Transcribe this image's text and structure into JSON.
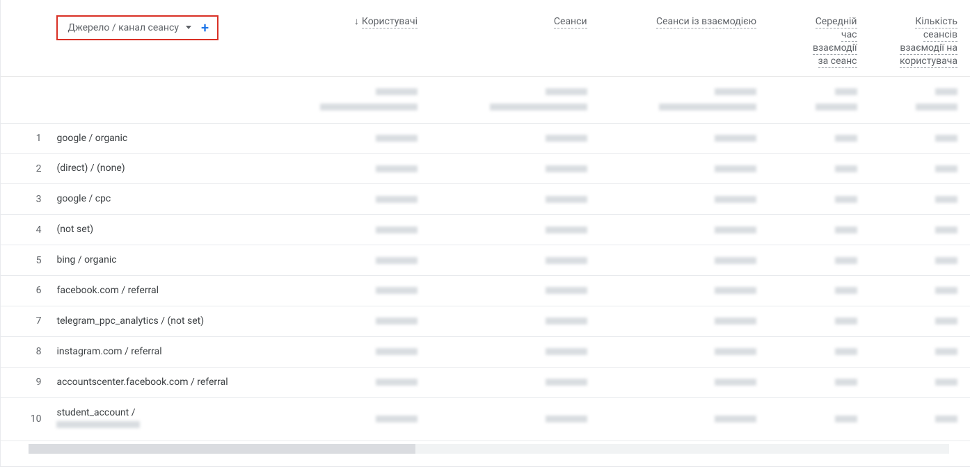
{
  "dimension": {
    "label": "Джерело / канал сеансу"
  },
  "columns": {
    "users": "Користувачі",
    "sessions": "Сеанси",
    "engaged_sessions": "Сеанси із взаємодією",
    "avg_engagement_time": [
      "Середній",
      "час",
      "взаємодії",
      "за сеанс"
    ],
    "sessions_per_user": [
      "Кількість",
      "сеансів",
      "взаємодії на",
      "користувача"
    ]
  },
  "sort": {
    "column": "users",
    "direction": "desc",
    "arrow": "↓"
  },
  "rows": [
    {
      "n": 1,
      "dim": "google / organic"
    },
    {
      "n": 2,
      "dim": "(direct) / (none)"
    },
    {
      "n": 3,
      "dim": "google / cpc"
    },
    {
      "n": 4,
      "dim": "(not set)"
    },
    {
      "n": 5,
      "dim": "bing / organic"
    },
    {
      "n": 6,
      "dim": "facebook.com / referral"
    },
    {
      "n": 7,
      "dim": "telegram_ppc_analytics / (not set)"
    },
    {
      "n": 8,
      "dim": "instagram.com / referral"
    },
    {
      "n": 9,
      "dim": "accountscenter.facebook.com / referral"
    },
    {
      "n": 10,
      "dim": "student_account / "
    }
  ]
}
